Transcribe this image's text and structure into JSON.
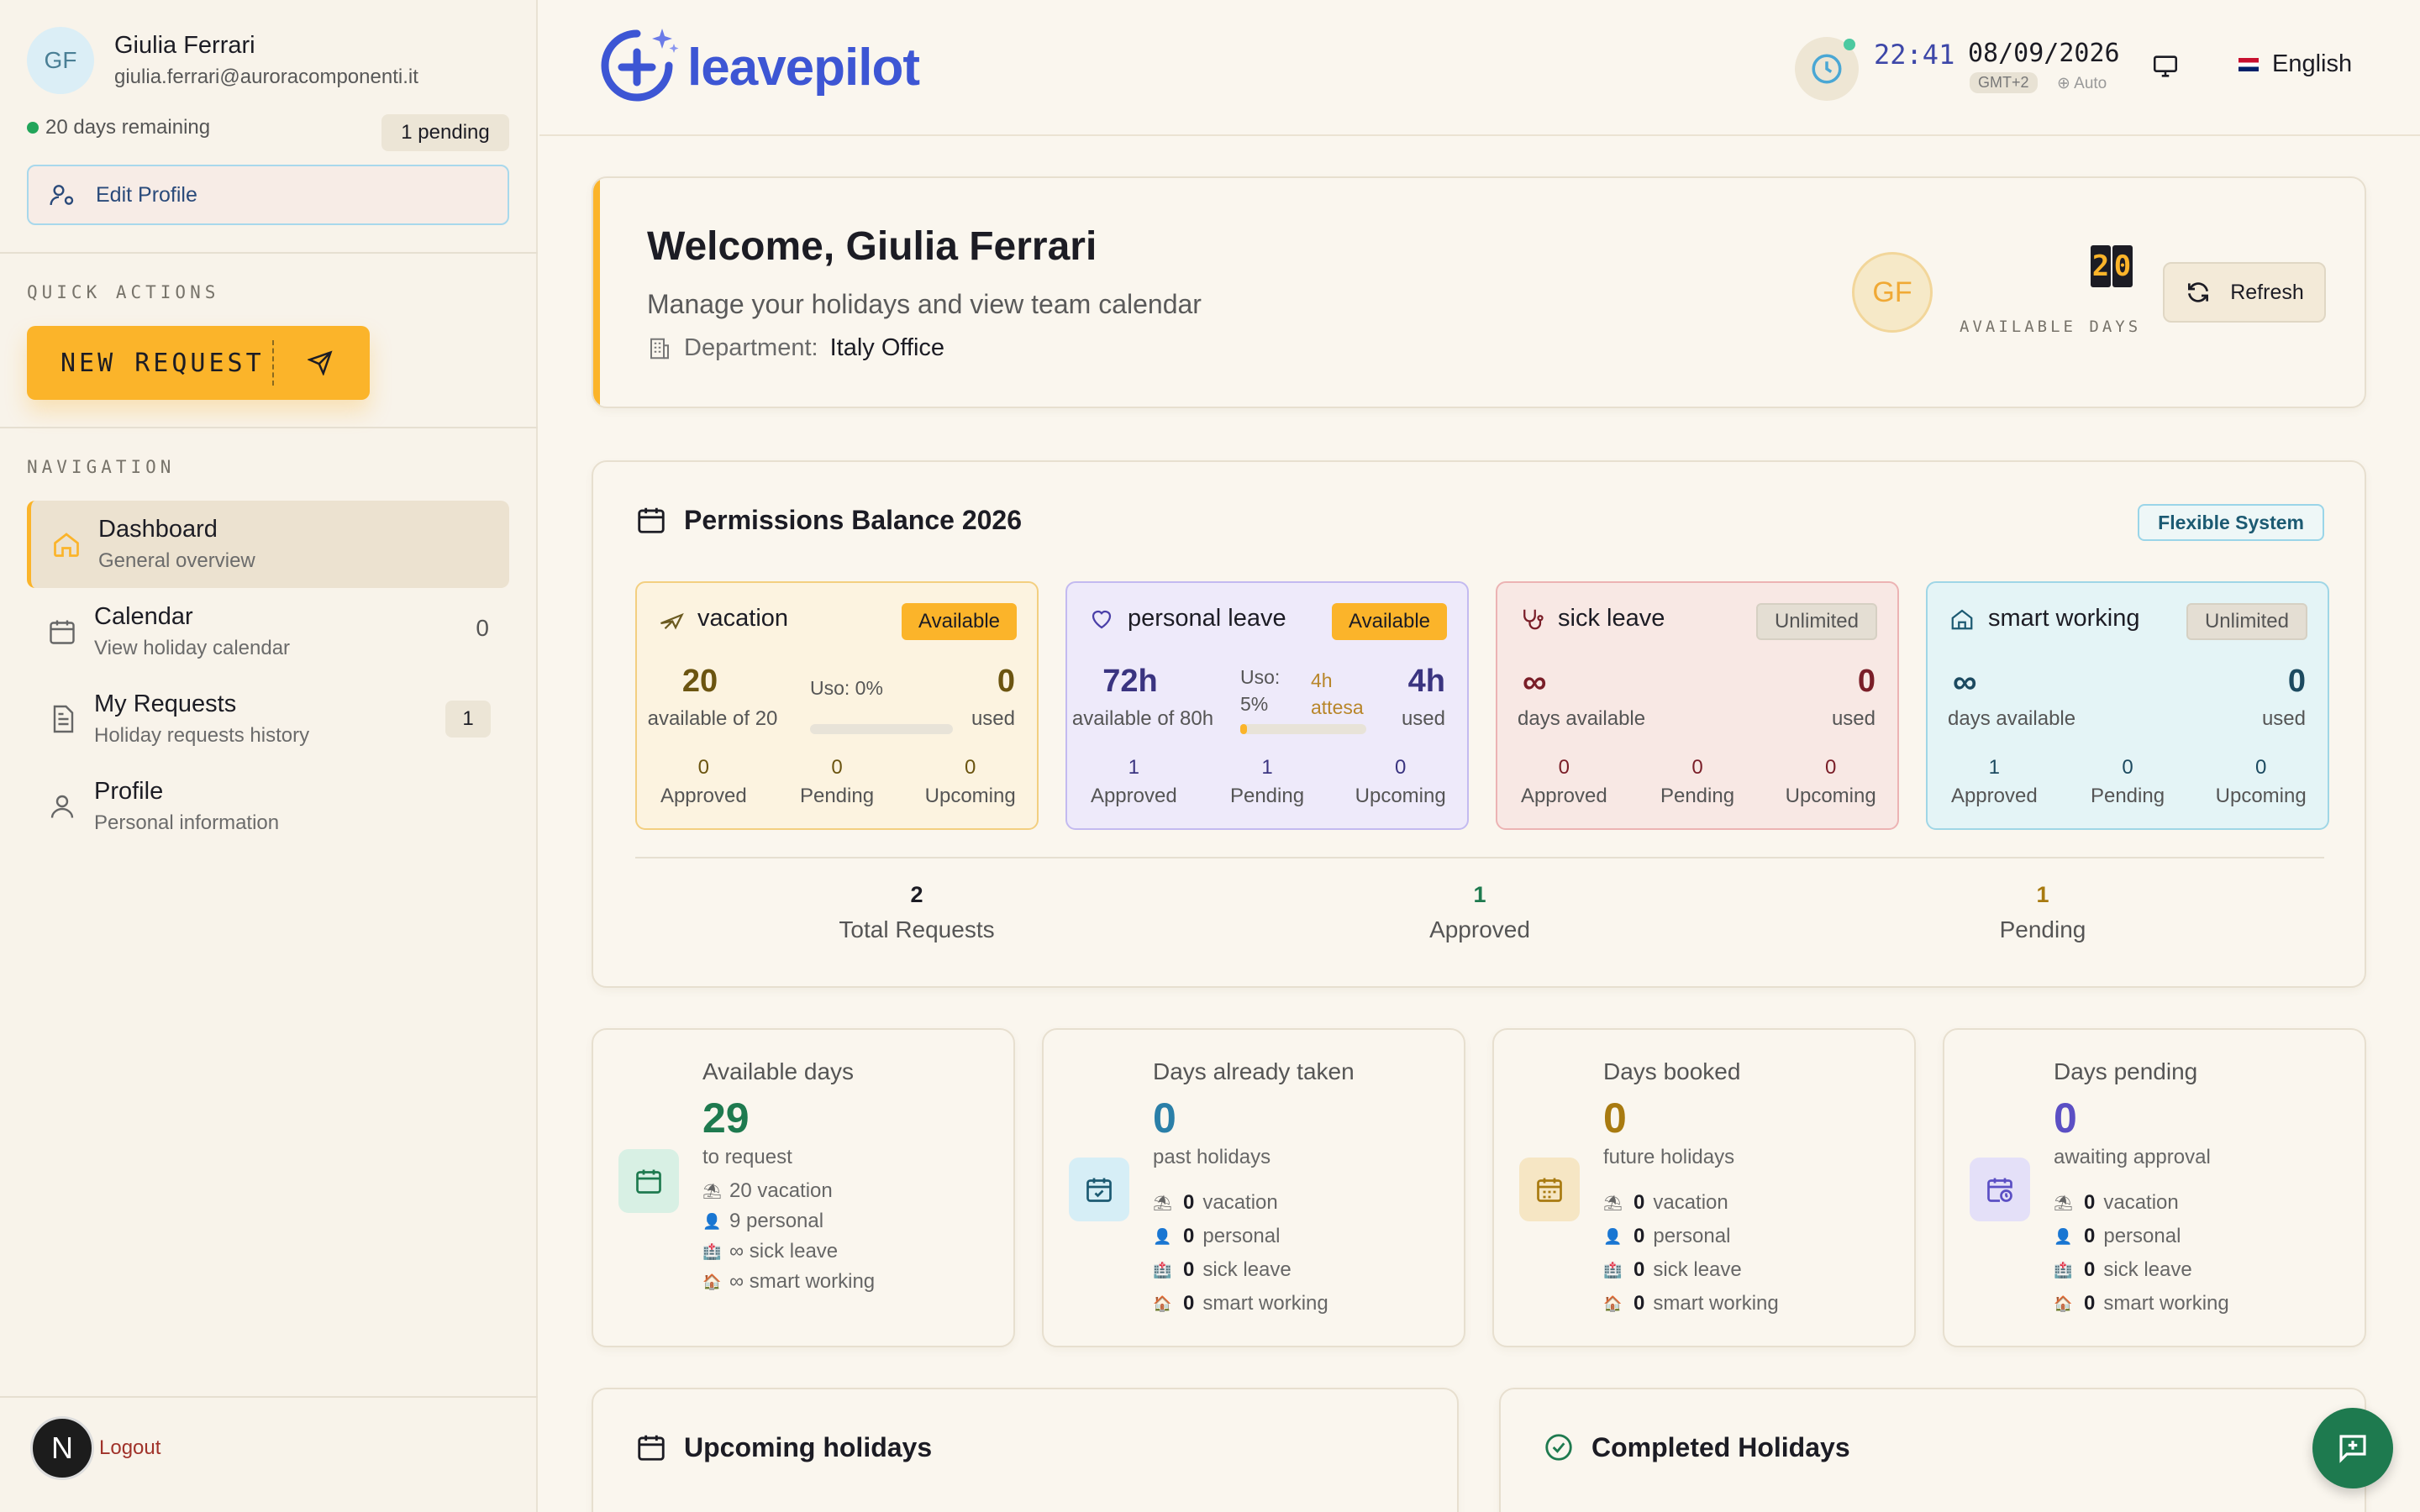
{
  "user": {
    "initials": "GF",
    "name": "Giulia Ferrari",
    "email": "giulia.ferrari@auroracomponenti.it",
    "remaining": "20 days remaining",
    "pending": "1 pending",
    "edit_profile": "Edit Profile"
  },
  "sidebar": {
    "quick_actions_label": "QUICK ACTIONS",
    "new_request": "NEW REQUEST",
    "navigation_label": "NAVIGATION",
    "items": [
      {
        "title": "Dashboard",
        "subtitle": "General overview",
        "count": ""
      },
      {
        "title": "Calendar",
        "subtitle": "View holiday calendar",
        "count": "0"
      },
      {
        "title": "My Requests",
        "subtitle": "Holiday requests history",
        "count": "1"
      },
      {
        "title": "Profile",
        "subtitle": "Personal information",
        "count": ""
      }
    ],
    "logout_initial": "N",
    "logout": "Logout"
  },
  "header": {
    "logo_text": "leavepilot",
    "time": "22:41",
    "date": "08/09/2026",
    "timezone": "GMT+2",
    "auto": "⊕ Auto",
    "language": "English"
  },
  "welcome": {
    "title": "Welcome, Giulia Ferrari",
    "subtitle": "Manage your holidays and view team calendar",
    "department_label": "Department:",
    "department": "Italy Office",
    "avatar_initials": "GF",
    "days_digit_1": "2",
    "days_digit_2": "0",
    "available_days_label": "AVAILABLE DAYS",
    "refresh": "Refresh"
  },
  "balance": {
    "title": "Permissions Balance 2026",
    "system_badge": "Flexible System",
    "types": [
      {
        "name": "vacation",
        "badge": "Available",
        "available": "20",
        "available_sub": "available of 20",
        "usage_label": "Uso: 0%",
        "usage_percent": 0,
        "used": "0",
        "used_label": "used",
        "approved": "0",
        "pending": "0",
        "upcoming": "0",
        "color": "#fbb42a"
      },
      {
        "name": "personal leave",
        "badge": "Available",
        "available": "72h",
        "available_sub": "available of 80h",
        "usage_label_1": "Uso:",
        "usage_label_2": "5%",
        "attesa_1": "4h",
        "attesa_2": "attesa",
        "usage_percent": 5,
        "used": "4h",
        "used_label": "used",
        "approved": "1",
        "pending": "1",
        "upcoming": "0",
        "color": "#9b8fe8"
      },
      {
        "name": "sick leave",
        "badge": "Unlimited",
        "available": "∞",
        "available_sub": "days available",
        "used": "0",
        "used_label": "used",
        "approved": "0",
        "pending": "0",
        "upcoming": "0",
        "color": "#e89a9a"
      },
      {
        "name": "smart working",
        "badge": "Unlimited",
        "available": "∞",
        "available_sub": "days available",
        "used": "0",
        "used_label": "used",
        "approved": "1",
        "pending": "0",
        "upcoming": "0",
        "color": "#8fd3e8"
      }
    ],
    "stat_labels": {
      "approved": "Approved",
      "pending": "Pending",
      "upcoming": "Upcoming"
    },
    "totals": [
      {
        "value": "2",
        "label": "Total Requests"
      },
      {
        "value": "1",
        "label": "Approved"
      },
      {
        "value": "1",
        "label": "Pending"
      }
    ]
  },
  "stats": [
    {
      "label": "Available days",
      "value": "29",
      "sub": "to request",
      "rows": [
        {
          "icon": "⛱",
          "text": "20 vacation"
        },
        {
          "icon": "👤",
          "text": "9 personal"
        },
        {
          "icon": "🏥",
          "text": "∞ sick leave"
        },
        {
          "icon": "🏠",
          "text": "∞ smart working"
        }
      ]
    },
    {
      "label": "Days already taken",
      "value": "0",
      "sub": "past holidays",
      "rows": [
        {
          "icon": "⛱",
          "count": "0",
          "text": "vacation"
        },
        {
          "icon": "👤",
          "count": "0",
          "text": "personal"
        },
        {
          "icon": "🏥",
          "count": "0",
          "text": "sick leave"
        },
        {
          "icon": "🏠",
          "count": "0",
          "text": "smart working"
        }
      ]
    },
    {
      "label": "Days booked",
      "value": "0",
      "sub": "future holidays",
      "rows": [
        {
          "icon": "⛱",
          "count": "0",
          "text": "vacation"
        },
        {
          "icon": "👤",
          "count": "0",
          "text": "personal"
        },
        {
          "icon": "🏥",
          "count": "0",
          "text": "sick leave"
        },
        {
          "icon": "🏠",
          "count": "0",
          "text": "smart working"
        }
      ]
    },
    {
      "label": "Days pending",
      "value": "0",
      "sub": "awaiting approval",
      "rows": [
        {
          "icon": "⛱",
          "count": "0",
          "text": "vacation"
        },
        {
          "icon": "👤",
          "count": "0",
          "text": "personal"
        },
        {
          "icon": "🏥",
          "count": "0",
          "text": "sick leave"
        },
        {
          "icon": "🏠",
          "count": "0",
          "text": "smart working"
        }
      ]
    }
  ],
  "bottom": {
    "upcoming_title": "Upcoming holidays",
    "completed_title": "Completed Holidays"
  },
  "colors": {
    "accent": "#fbb42a",
    "brand_blue": "#3d56d4",
    "green": "#1e7a4f",
    "amber_text": "#a87a10",
    "purple_text": "#5b4fc4"
  }
}
